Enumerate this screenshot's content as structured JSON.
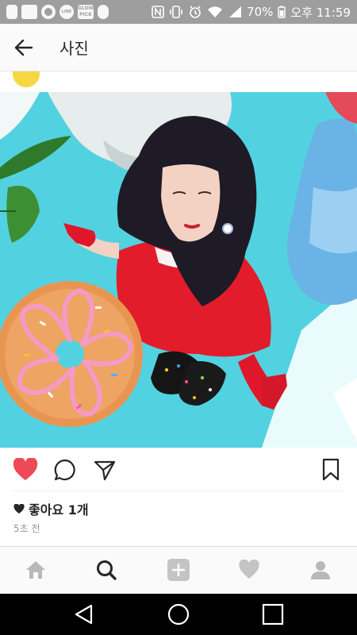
{
  "status_bar": {
    "icons": [
      "notification-icon",
      "line-app-icon",
      "glow-pick-app-icon",
      "nfc-icon",
      "vibrate-icon",
      "alarm-icon",
      "wifi-icon",
      "signal-icon"
    ],
    "line_label": "LINE",
    "glow_label": "GLOW PICK",
    "battery": "70%",
    "time": "오후 11:59"
  },
  "app_bar": {
    "title": "사진",
    "back_icon": "arrow-left-icon"
  },
  "post": {
    "photo": "member-in-red-dress-with-donut-on-cyan-background",
    "actions": [
      "heart-filled-icon",
      "comment-icon",
      "share-icon",
      "bookmark-icon"
    ],
    "like_color": "#ed4956",
    "likes_label": "좋아요 1개",
    "time_ago": "5초 전"
  },
  "bottom_nav": {
    "items": [
      "home-icon",
      "search-icon",
      "add-icon",
      "heart-icon",
      "profile-icon"
    ],
    "active": "search-icon"
  },
  "system_nav": {
    "buttons": [
      "back-triangle-icon",
      "home-circle-icon",
      "recents-square-icon"
    ]
  }
}
